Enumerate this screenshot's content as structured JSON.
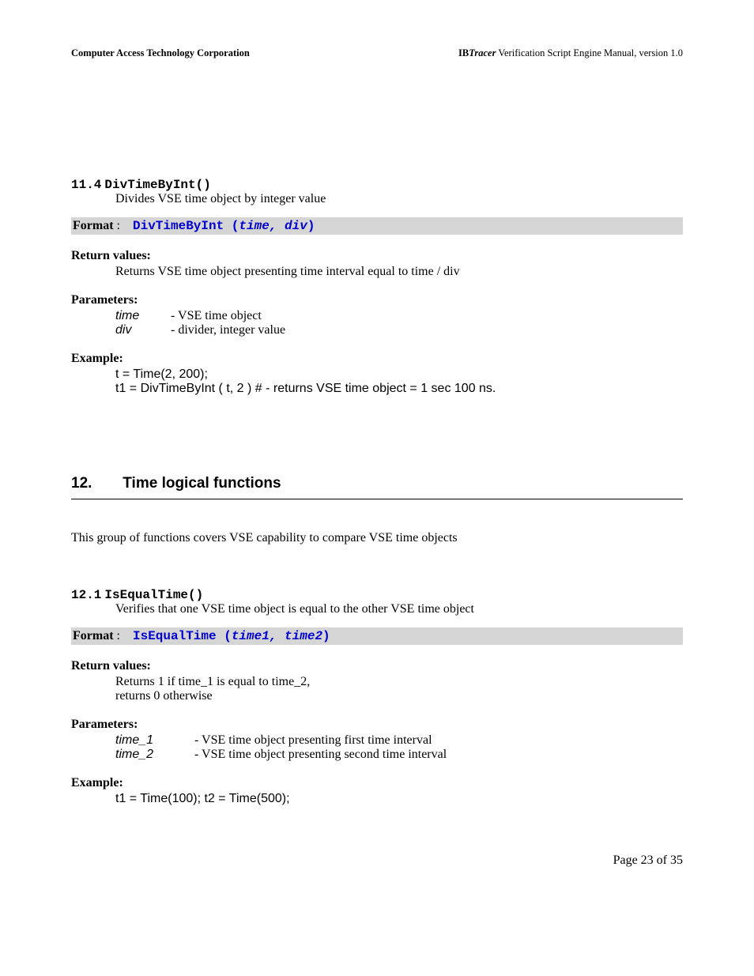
{
  "header": {
    "left": "Computer Access Technology Corporation",
    "right_prefix": "IB",
    "right_italic": "Tracer",
    "right_suffix": " Verification Script Engine Manual, version 1.0"
  },
  "sec114": {
    "num": "11.4",
    "title": "DivTimeByInt()",
    "desc": "Divides VSE time object by integer value",
    "format_label": "Format",
    "format_fn": "DivTimeByInt (",
    "format_arg1": "time",
    "format_sep": ", ",
    "format_arg2": "div",
    "format_close": ")",
    "rv_label": "Return values:",
    "rv_text": "Returns VSE time object presenting time interval equal to time / div",
    "params_label": "Parameters:",
    "p1_name": "time",
    "p1_desc": "-  VSE time object",
    "p2_name": "div",
    "p2_desc": "-  divider, integer value",
    "ex_label": "Example:",
    "ex_l1": "t   = Time(2, 200);",
    "ex_l2": "t1 = DivTimeByInt ( t, 2 )   # - returns VSE time object = 1 sec 100 ns."
  },
  "chapter12": {
    "num": "12.",
    "title": "Time logical functions",
    "intro": "This group of functions covers VSE capability to compare VSE time objects"
  },
  "sec121": {
    "num": "12.1",
    "title": "IsEqualTime()",
    "desc": "Verifies that one VSE time object is equal to the other VSE time object",
    "format_label": "Format",
    "format_fn": "IsEqualTime (",
    "format_arg1": "time1",
    "format_sep": ", ",
    "format_arg2": "time2",
    "format_close": ")",
    "rv_label": "Return values:",
    "rv_l1": "Returns 1 if time_1 is equal to time_2,",
    "rv_l2": "returns  0 otherwise",
    "params_label": "Parameters:",
    "p1_name": "time_1",
    "p1_desc": "-  VSE time object presenting first time interval",
    "p2_name": "time_2",
    "p2_desc": "-  VSE time object presenting second time interval",
    "ex_label": "Example:",
    "ex_l1": "t1 = Time(100);  t2 = Time(500);"
  },
  "footer": "Page 23 of 35"
}
